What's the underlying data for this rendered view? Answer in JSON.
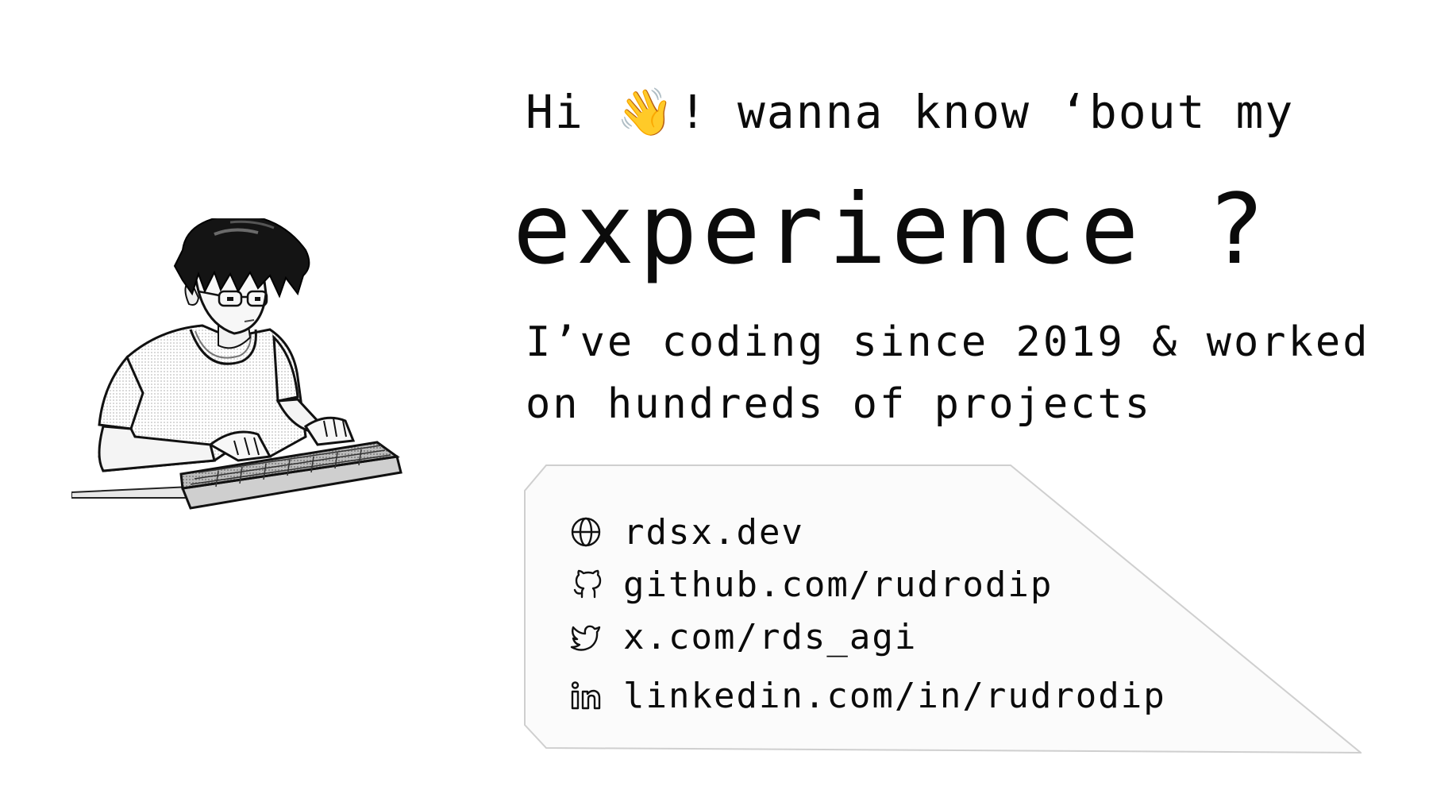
{
  "greeting": {
    "before": "Hi",
    "wave_icon": "waving-hand-icon",
    "wave_glyph": "👋",
    "after": "! wanna know ‘bout my"
  },
  "headline": "experience ?",
  "subline": {
    "line1": "I’ve coding since 2019 & worked",
    "line2": "on hundreds of projects"
  },
  "links": [
    {
      "icon": "globe-icon",
      "text": "rdsx.dev"
    },
    {
      "icon": "github-icon",
      "text": "github.com/rudrodip"
    },
    {
      "icon": "twitter-icon",
      "text": "x.com/rds_agi"
    },
    {
      "icon": "linkedin-icon",
      "text": "linkedin.com/in/rudrodip"
    }
  ],
  "colors": {
    "text": "#0b0b0b",
    "card_fill": "#fbfbfb",
    "card_border": "#cfcfcf",
    "wave": "#e9b23a"
  }
}
